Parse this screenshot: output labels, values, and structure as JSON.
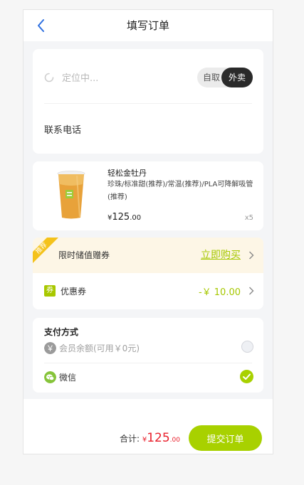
{
  "header": {
    "title": "填写订单",
    "back_icon": "chevron-left-icon"
  },
  "address": {
    "locating_text": "定位中...",
    "mode_self": "自取",
    "mode_delivery": "外卖",
    "phone_label": "联系电话",
    "phone_value": ""
  },
  "product": {
    "name": "轻松金牡丹",
    "spec": "珍珠/标准甜(推荐)/常温(推荐)/PLA可降解吸管(推荐)",
    "price_symbol": "¥",
    "price_int": "125",
    "price_dec": ".00",
    "quantity": "x5"
  },
  "coupons": {
    "badge_text": "推荐",
    "stored_label": "限时储值赠券",
    "stored_action": "立即购买",
    "coupon_icon_text": "券",
    "coupon_label": "优惠券",
    "coupon_value": "-￥ 10.00"
  },
  "payment": {
    "title": "支付方式",
    "balance_icon_text": "￥",
    "balance_label": "会员余额(可用￥0元)",
    "wechat_label": "微信",
    "selected": "wechat"
  },
  "footer": {
    "total_label": "合计:",
    "total_symbol": "¥",
    "total_int": "125",
    "total_dec": ".00",
    "submit_label": "提交订单"
  },
  "colors": {
    "accent": "#a8d100",
    "price_red": "#e9202c",
    "back_blue": "#2d6fe0"
  }
}
